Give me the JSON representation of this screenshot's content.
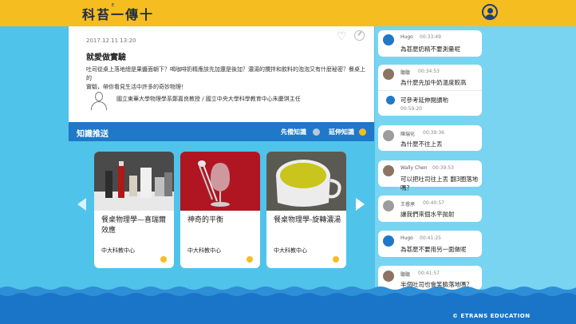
{
  "header": {
    "logo": "科苔一傳十",
    "logo_sup": "E"
  },
  "article": {
    "date": "2017.12.11 13:20",
    "title": "就愛做實驗",
    "body_line1": "吐司從桌上落地總是果醬面朝下？喝咖啡奶精應該先加還是後加？濃湯的攪拌和飲料的泡泡又有什麼秘密？餐桌上的",
    "body_line2": "實驗，帶你看見生活中許多的奇妙物理！",
    "author": "國立東華大學物理學系鄭嘉良教授 / 國立中央大學科學教育中心朱慶琪主任"
  },
  "knowledge": {
    "title": "知識推送",
    "tag_prior": "先備知識",
    "tag_extend": "延伸知識"
  },
  "cards": [
    {
      "title": "餐桌物理學—喜瑞爾效應",
      "source": "中大科教中心"
    },
    {
      "title": "神奇的平衡",
      "source": "中大科教中心"
    },
    {
      "title": "餐桌物理學-旋轉濃湯",
      "source": "中大科教中心"
    }
  ],
  "chat": [
    {
      "name": "Hugo",
      "time": "00:33:49",
      "msg": "為甚麼奶精不要測量呢"
    },
    {
      "name": "聽聽",
      "time": "00:34:53",
      "msg": "為什麼先加牛奶溫度較高",
      "reply": {
        "msg": "可參考延伸閱讀喲",
        "time": "00:59:20"
      }
    },
    {
      "name": "陳瑞化",
      "time": "00:39:36",
      "msg": "為什麼不往上丟"
    },
    {
      "name": "Wally Chen",
      "time": "00:39:53",
      "msg": "可以把吐司往上丟 翻3圈落地嗎？"
    },
    {
      "name": "王睿承",
      "time": "00:40:57",
      "msg": "讓我們來個水平拋射"
    },
    {
      "name": "Hugo",
      "time": "00:41:25",
      "msg": "為甚麼不要用另一面做呢"
    },
    {
      "name": "聽聽",
      "time": "00:41:57",
      "msg": "半個吐司也會笑臉落地嗎？"
    }
  ],
  "footer": {
    "text": "© ETRANS EDUCATION"
  },
  "colors": {
    "top_bar": "#f5bd1f",
    "background": "#4fc3ea",
    "bar_blue": "#1f78c8",
    "wave": "#1a75c9"
  }
}
